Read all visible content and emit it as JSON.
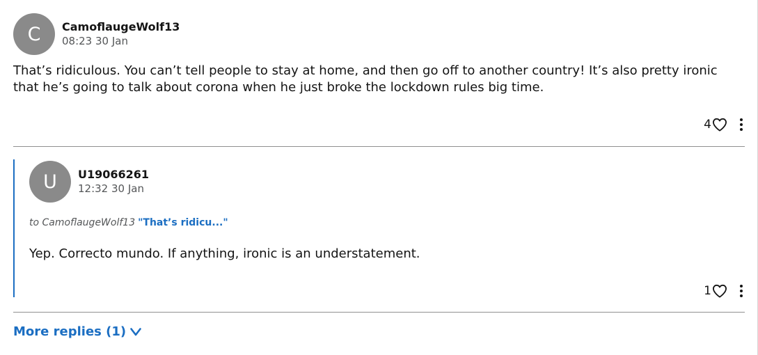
{
  "comment": {
    "avatar_initial": "C",
    "author": "CamoflaugeWolf13",
    "timestamp": "08:23 30 Jan",
    "text_line1": "That’s ridiculous. You can’t tell people to stay at home, and then go off to another country! It’s also pretty ironic",
    "text_line2": "that he’s going to talk about corona when he just broke the lockdown rules big time.",
    "likes": "4"
  },
  "reply": {
    "avatar_initial": "U",
    "author": "U19066261",
    "timestamp": "12:32 30 Jan",
    "to_label": "to CamoflaugeWolf13",
    "quote": "\"That’s ridicu...\"",
    "text": "Yep. Correcto mundo. If anything, ironic is an understatement.",
    "likes": "1"
  },
  "more_replies_label": "More replies (1)",
  "colors": {
    "accent": "#1b6ec2",
    "avatar": "#8a8a8a",
    "muted_text": "#545658"
  },
  "icons": [
    "heart-icon",
    "more-options-icon",
    "chevron-down-icon"
  ]
}
